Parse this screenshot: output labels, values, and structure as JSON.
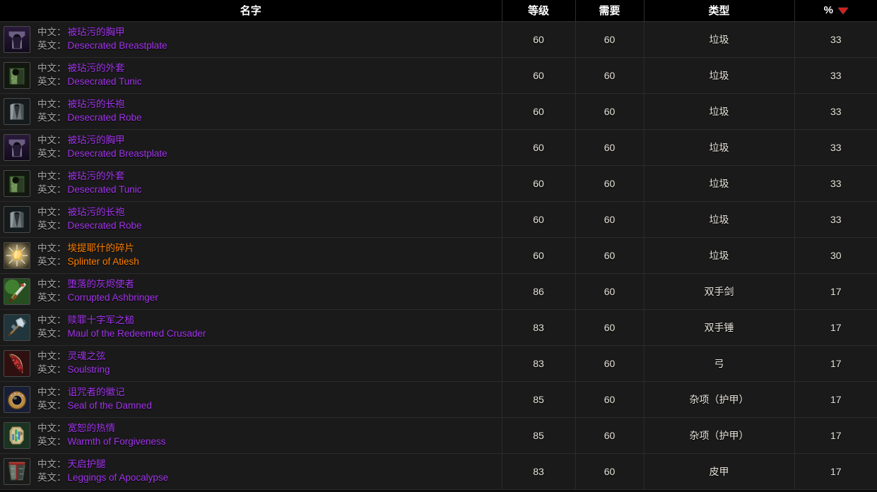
{
  "table": {
    "columns": [
      {
        "key": "name",
        "label": "名字"
      },
      {
        "key": "level",
        "label": "等级"
      },
      {
        "key": "req",
        "label": "需要"
      },
      {
        "key": "type",
        "label": "类型"
      },
      {
        "key": "pct",
        "label": "%"
      }
    ],
    "sort": {
      "column": "pct",
      "direction": "desc",
      "icon": "sort-desc-arrow-icon",
      "color": "#d02020"
    },
    "label_cn": "中文：",
    "label_en": "英文：",
    "quality_colors": {
      "epic": "#a335ee",
      "legendary": "#ff8000"
    },
    "rows": [
      {
        "icon": "desecrated-breastplate-icon",
        "name_cn": "被玷污的胸甲",
        "name_en": "Desecrated Breastplate",
        "quality": "epic",
        "level": "60",
        "req": "60",
        "type": "垃圾",
        "pct": "33"
      },
      {
        "icon": "desecrated-tunic-icon",
        "name_cn": "被玷污的外套",
        "name_en": "Desecrated Tunic",
        "quality": "epic",
        "level": "60",
        "req": "60",
        "type": "垃圾",
        "pct": "33"
      },
      {
        "icon": "desecrated-robe-icon",
        "name_cn": "被玷污的长袍",
        "name_en": "Desecrated Robe",
        "quality": "epic",
        "level": "60",
        "req": "60",
        "type": "垃圾",
        "pct": "33"
      },
      {
        "icon": "desecrated-breastplate-icon",
        "name_cn": "被玷污的胸甲",
        "name_en": "Desecrated Breastplate",
        "quality": "epic",
        "level": "60",
        "req": "60",
        "type": "垃圾",
        "pct": "33"
      },
      {
        "icon": "desecrated-tunic-icon",
        "name_cn": "被玷污的外套",
        "name_en": "Desecrated Tunic",
        "quality": "epic",
        "level": "60",
        "req": "60",
        "type": "垃圾",
        "pct": "33"
      },
      {
        "icon": "desecrated-robe-icon",
        "name_cn": "被玷污的长袍",
        "name_en": "Desecrated Robe",
        "quality": "epic",
        "level": "60",
        "req": "60",
        "type": "垃圾",
        "pct": "33"
      },
      {
        "icon": "splinter-of-atiesh-icon",
        "name_cn": "埃提耶什的碎片",
        "name_en": "Splinter of Atiesh",
        "quality": "legendary",
        "level": "60",
        "req": "60",
        "type": "垃圾",
        "pct": "30"
      },
      {
        "icon": "corrupted-ashbringer-icon",
        "name_cn": "堕落的灰烬使者",
        "name_en": "Corrupted Ashbringer",
        "quality": "epic",
        "level": "86",
        "req": "60",
        "type": "双手剑",
        "pct": "17"
      },
      {
        "icon": "maul-of-the-redeemed-crusader-icon",
        "name_cn": "赎罪十字军之槌",
        "name_en": "Maul of the Redeemed Crusader",
        "quality": "epic",
        "level": "83",
        "req": "60",
        "type": "双手锤",
        "pct": "17"
      },
      {
        "icon": "soulstring-icon",
        "name_cn": "灵魂之弦",
        "name_en": "Soulstring",
        "quality": "epic",
        "level": "83",
        "req": "60",
        "type": "弓",
        "pct": "17"
      },
      {
        "icon": "seal-of-the-damned-icon",
        "name_cn": "诅咒者的徽记",
        "name_en": "Seal of the Damned",
        "quality": "epic",
        "level": "85",
        "req": "60",
        "type": "杂项（护甲）",
        "pct": "17"
      },
      {
        "icon": "warmth-of-forgiveness-icon",
        "name_cn": "宽恕的热情",
        "name_en": "Warmth of Forgiveness",
        "quality": "epic",
        "level": "85",
        "req": "60",
        "type": "杂项（护甲）",
        "pct": "17"
      },
      {
        "icon": "leggings-of-apocalypse-icon",
        "name_cn": "天启护腿",
        "name_en": "Leggings of Apocalypse",
        "quality": "epic",
        "level": "83",
        "req": "60",
        "type": "皮甲",
        "pct": "17"
      }
    ]
  }
}
